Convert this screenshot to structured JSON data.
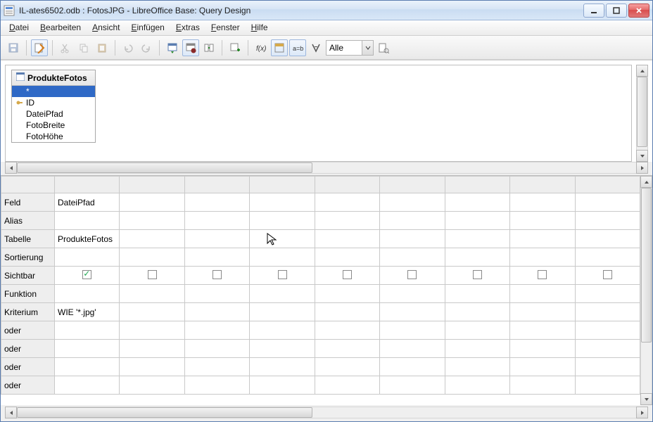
{
  "window": {
    "title": "IL-ates6502.odb : FotosJPG - LibreOffice Base: Query Design"
  },
  "menu": {
    "items": [
      {
        "label": "Datei",
        "ul": "D"
      },
      {
        "label": "Bearbeiten",
        "ul": "B"
      },
      {
        "label": "Ansicht",
        "ul": "A"
      },
      {
        "label": "Einfügen",
        "ul": "E"
      },
      {
        "label": "Extras",
        "ul": "E"
      },
      {
        "label": "Fenster",
        "ul": "F"
      },
      {
        "label": "Hilfe",
        "ul": "H"
      }
    ]
  },
  "toolbar": {
    "limit_value": "Alle"
  },
  "tables_pane": {
    "table_name": "ProdukteFotos",
    "fields": [
      {
        "name": "*",
        "pk": false,
        "selected": true
      },
      {
        "name": "ID",
        "pk": true,
        "selected": false
      },
      {
        "name": "DateiPfad",
        "pk": false,
        "selected": false
      },
      {
        "name": "FotoBreite",
        "pk": false,
        "selected": false
      },
      {
        "name": "FotoHöhe",
        "pk": false,
        "selected": false
      }
    ]
  },
  "grid": {
    "row_labels": {
      "field": "Feld",
      "alias": "Alias",
      "table": "Tabelle",
      "sort": "Sortierung",
      "visible": "Sichtbar",
      "function": "Funktion",
      "criterion": "Kriterium",
      "or1": "oder",
      "or2": "oder",
      "or3": "oder",
      "or4": "oder"
    },
    "columns": [
      {
        "field": "DateiPfad",
        "alias": "",
        "table": "ProdukteFotos",
        "sort": "",
        "visible": true,
        "function": "",
        "criterion": "WIE '*.jpg'"
      },
      {
        "field": "",
        "alias": "",
        "table": "",
        "sort": "",
        "visible": false,
        "function": "",
        "criterion": ""
      },
      {
        "field": "",
        "alias": "",
        "table": "",
        "sort": "",
        "visible": false,
        "function": "",
        "criterion": ""
      },
      {
        "field": "",
        "alias": "",
        "table": "",
        "sort": "",
        "visible": false,
        "function": "",
        "criterion": ""
      },
      {
        "field": "",
        "alias": "",
        "table": "",
        "sort": "",
        "visible": false,
        "function": "",
        "criterion": ""
      },
      {
        "field": "",
        "alias": "",
        "table": "",
        "sort": "",
        "visible": false,
        "function": "",
        "criterion": ""
      },
      {
        "field": "",
        "alias": "",
        "table": "",
        "sort": "",
        "visible": false,
        "function": "",
        "criterion": ""
      },
      {
        "field": "",
        "alias": "",
        "table": "",
        "sort": "",
        "visible": false,
        "function": "",
        "criterion": ""
      },
      {
        "field": "",
        "alias": "",
        "table": "",
        "sort": "",
        "visible": false,
        "function": "",
        "criterion": ""
      }
    ]
  }
}
